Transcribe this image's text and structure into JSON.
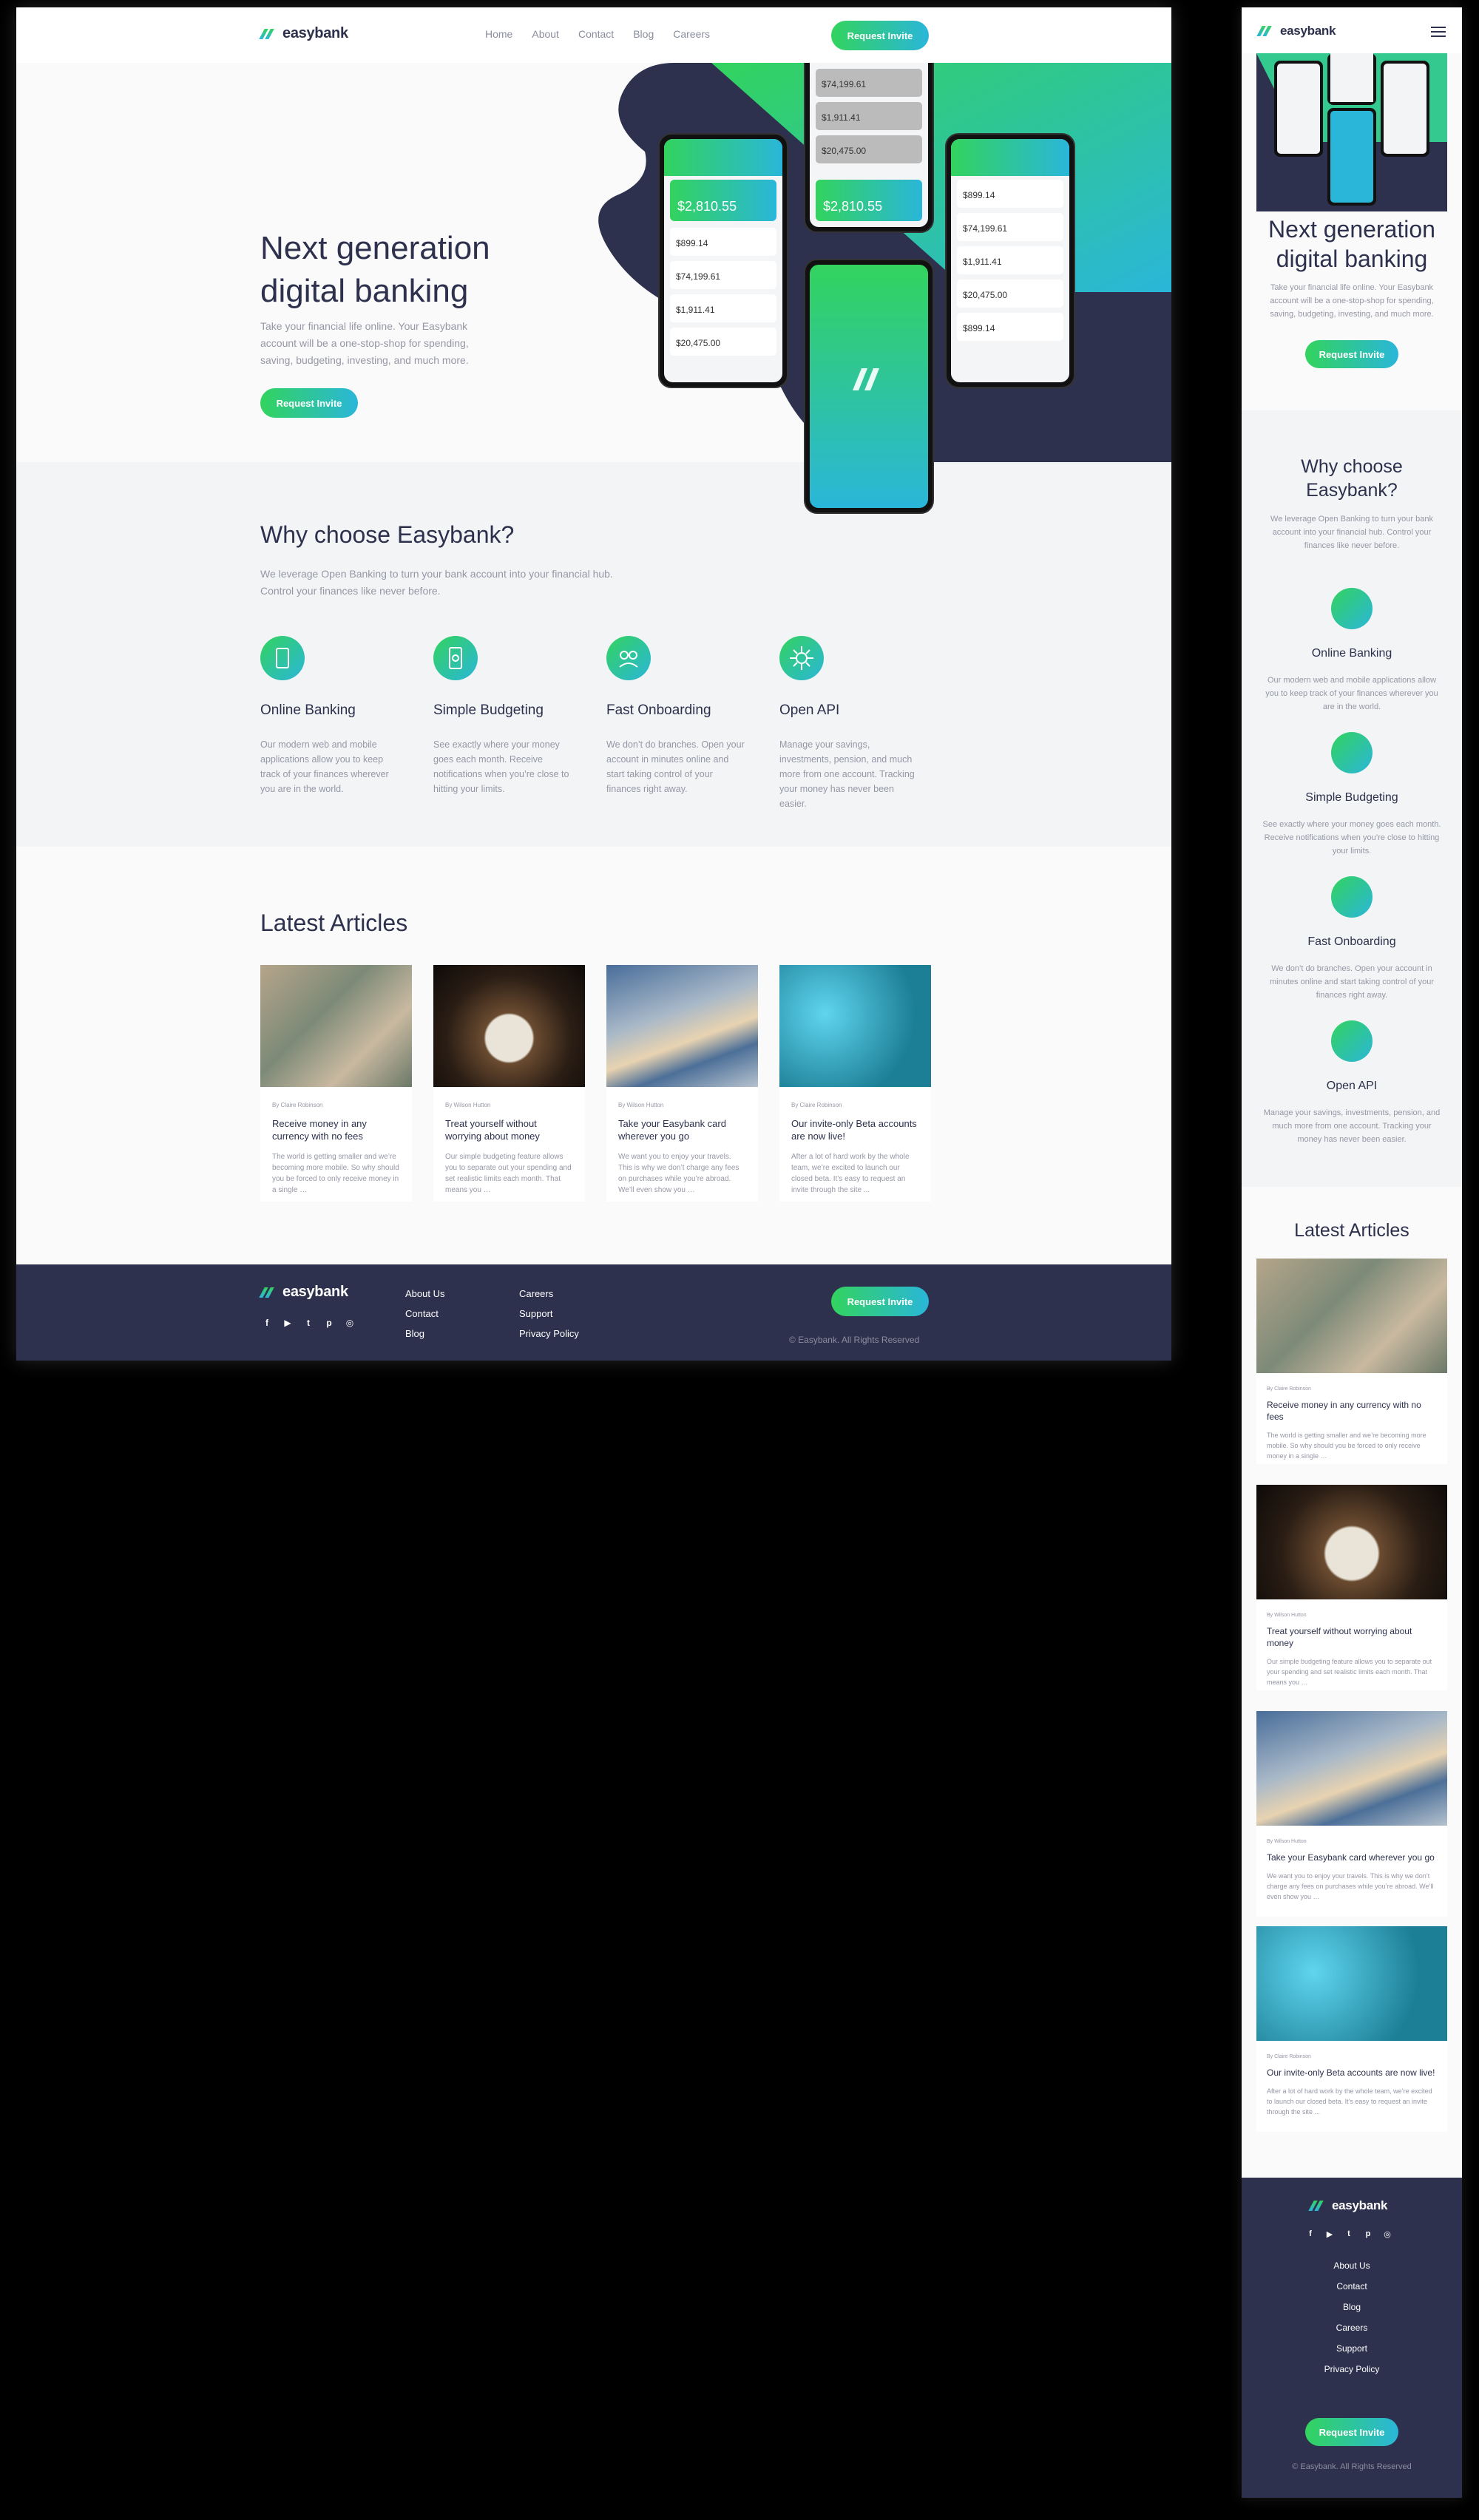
{
  "brand": {
    "name": "easybank"
  },
  "nav": {
    "links": [
      "Home",
      "About",
      "Contact",
      "Blog",
      "Careers"
    ],
    "cta": "Request Invite"
  },
  "hero": {
    "title": "Next generation digital banking",
    "text": "Take your financial life online. Your Easybank account will be a one-stop-shop for spending, saving, budgeting, investing, and much more.",
    "cta": "Request Invite"
  },
  "phones": {
    "balance": "$2,810.55",
    "amounts": [
      "$899.14",
      "$74,199.61",
      "$1,911.41",
      "$20,475.00"
    ]
  },
  "why": {
    "title": "Why choose Easybank?",
    "lead": "We leverage Open Banking to turn your bank account into your financial hub. Control your finances like never before.",
    "features": [
      {
        "icon": "online-banking-icon",
        "title": "Online Banking",
        "text": "Our modern web and mobile applications allow you to keep track of your finances wherever you are in the world."
      },
      {
        "icon": "budgeting-icon",
        "title": "Simple Budgeting",
        "text": "See exactly where your money goes each month. Receive notifications when you’re close to hitting your limits."
      },
      {
        "icon": "onboarding-icon",
        "title": "Fast Onboarding",
        "text": "We don’t do branches. Open your account in minutes online and start taking control of your finances right away."
      },
      {
        "icon": "api-icon",
        "title": "Open API",
        "text": "Manage your savings, investments, pension, and much more from one account. Tracking your money has never been easier."
      }
    ]
  },
  "articles": {
    "title": "Latest Articles",
    "items": [
      {
        "by": "By Claire Robinson",
        "title": "Receive money in any currency with no fees",
        "text": "The world is getting smaller and we’re becoming more mobile. So why should you be forced to only receive money in a single …"
      },
      {
        "by": "By Wilson Hutton",
        "title": "Treat yourself without worrying about money",
        "text": "Our simple budgeting feature allows you to separate out your spending and set realistic limits each month. That means you …"
      },
      {
        "by": "By Wilson Hutton",
        "title": "Take your Easybank card wherever you go",
        "text": "We want you to enjoy your travels. This is why we don’t charge any fees on purchases while you’re abroad. We’ll even show you …"
      },
      {
        "by": "By Claire Robinson",
        "title": "Our invite-only Beta accounts are now live!",
        "text": "After a lot of hard work by the whole team, we’re excited to launch our closed beta. It’s easy to request an invite through the site ..."
      }
    ]
  },
  "footer": {
    "col1": [
      "About Us",
      "Contact",
      "Blog"
    ],
    "col2": [
      "Careers",
      "Support",
      "Privacy Policy"
    ],
    "cta": "Request Invite",
    "copyright": "© Easybank. All Rights Reserved",
    "socials": [
      "facebook-icon",
      "youtube-icon",
      "twitter-icon",
      "pinterest-icon",
      "instagram-icon"
    ]
  },
  "colors": {
    "dark_blue": "#2d314d",
    "lime_green": "#33d35e",
    "bright_cyan": "#2ab6d9",
    "grayish_blue": "#9597a6"
  }
}
